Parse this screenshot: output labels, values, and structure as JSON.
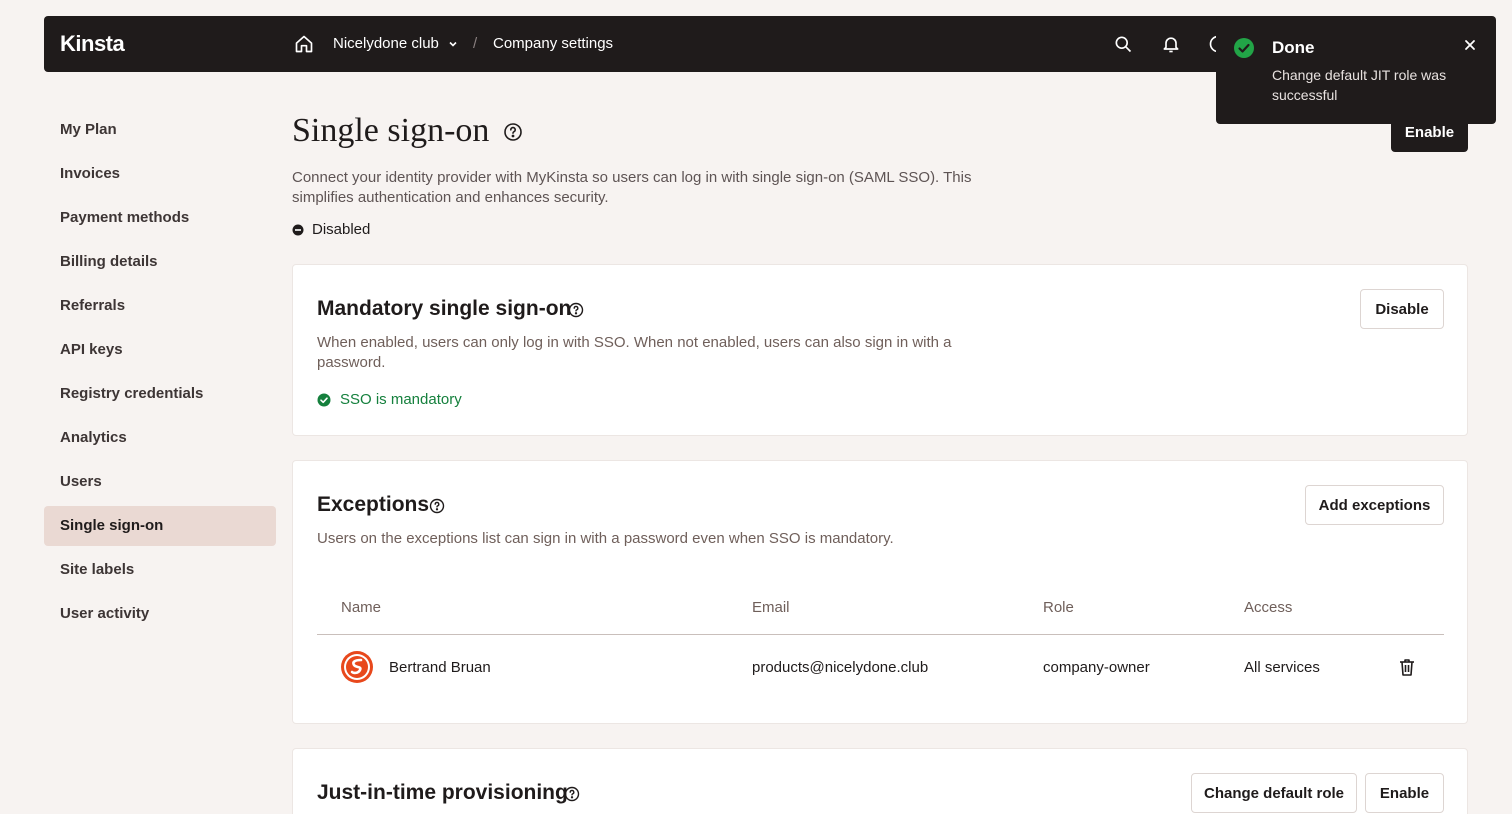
{
  "topbar": {
    "logo": "Kinsta",
    "company": "Nicelydone club",
    "separator": "/",
    "page": "Company settings"
  },
  "toast": {
    "title": "Done",
    "message": "Change default JIT role was successful"
  },
  "sidebar": {
    "items": [
      {
        "label": "My Plan"
      },
      {
        "label": "Invoices"
      },
      {
        "label": "Payment methods"
      },
      {
        "label": "Billing details"
      },
      {
        "label": "Referrals"
      },
      {
        "label": "API keys"
      },
      {
        "label": "Registry credentials"
      },
      {
        "label": "Analytics"
      },
      {
        "label": "Users"
      },
      {
        "label": "Single sign-on",
        "active": true
      },
      {
        "label": "Site labels"
      },
      {
        "label": "User activity"
      }
    ]
  },
  "main": {
    "title": "Single sign-on",
    "enable_label": "Enable",
    "description": "Connect your identity provider with MyKinsta so users can log in with single sign-on (SAML SSO). This simplifies authentication and enhances security.",
    "status": "Disabled"
  },
  "mandatory": {
    "title": "Mandatory single sign-on",
    "description": "When enabled, users can only log in with SSO. When not enabled, users can also sign in with a password.",
    "button": "Disable",
    "status": "SSO is mandatory"
  },
  "exceptions": {
    "title": "Exceptions",
    "description": "Users on the exceptions list can sign in with a password even when SSO is mandatory.",
    "button": "Add exceptions",
    "columns": [
      "Name",
      "Email",
      "Role",
      "Access"
    ],
    "rows": [
      {
        "name": "Bertrand Bruan",
        "email": "products@nicelydone.club",
        "role": "company-owner",
        "access": "All services"
      }
    ]
  },
  "jit": {
    "title": "Just-in-time provisioning",
    "change_role_button": "Change default role",
    "enable_button": "Enable"
  },
  "colors": {
    "topbar": "#1f1b1b",
    "background": "#f7f3f1",
    "active_sidebar": "#ead9d3",
    "success": "#15803d",
    "avatar": "#e8481c"
  },
  "icons": [
    "home-icon",
    "chevron-down-icon",
    "search-icon",
    "bell-icon",
    "help-icon",
    "check-circle-icon",
    "close-icon",
    "minus-circle-icon",
    "trash-icon"
  ]
}
